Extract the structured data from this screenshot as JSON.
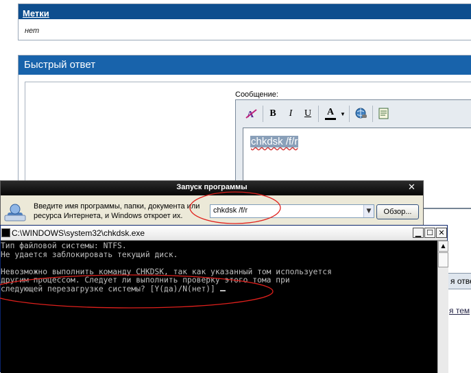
{
  "forum": {
    "tags_title": "Метки",
    "tags_value": "нет",
    "quick_reply_title": "Быстрый ответ",
    "message_label": "Сообщение:",
    "editor_text": "chkdsk /f/r",
    "reply_button_fragment": "я отве",
    "topic_link_fragment": "я тем"
  },
  "toolbar": {
    "bold": "B",
    "italic": "I",
    "underline": "U",
    "font_color": "A"
  },
  "run_dialog": {
    "title": "Запуск программы",
    "prompt": "Введите имя программы, папки, документа или ресурса Интернета, и Windows откроет их.",
    "input_value": "chkdsk /f/r",
    "browse_label": "Обзор..."
  },
  "console": {
    "title": "C:\\WINDOWS\\system32\\chkdsk.exe",
    "lines": [
      "Тип файловой системы: NTFS.",
      "Не удается заблокировать текущий диск.",
      "",
      "Невозможно выполнить команду CHKDSK, так как указанный том используется",
      "другим процессом. Следует ли выполнить проверку этого тома при",
      "следующей перезагрузке системы? [Y(да)/N(нет)] "
    ]
  },
  "colors": {
    "forum_header": "#0e4e8e",
    "quick_reply_header": "#1863ab",
    "annotation": "#e0201c",
    "console_bg": "#000000",
    "console_fg": "#c0c0c0"
  },
  "icons": {
    "remove_format": "remove-format-icon",
    "link": "globe-link-icon",
    "quote": "quote-icon",
    "run": "run-dialog-icon"
  }
}
